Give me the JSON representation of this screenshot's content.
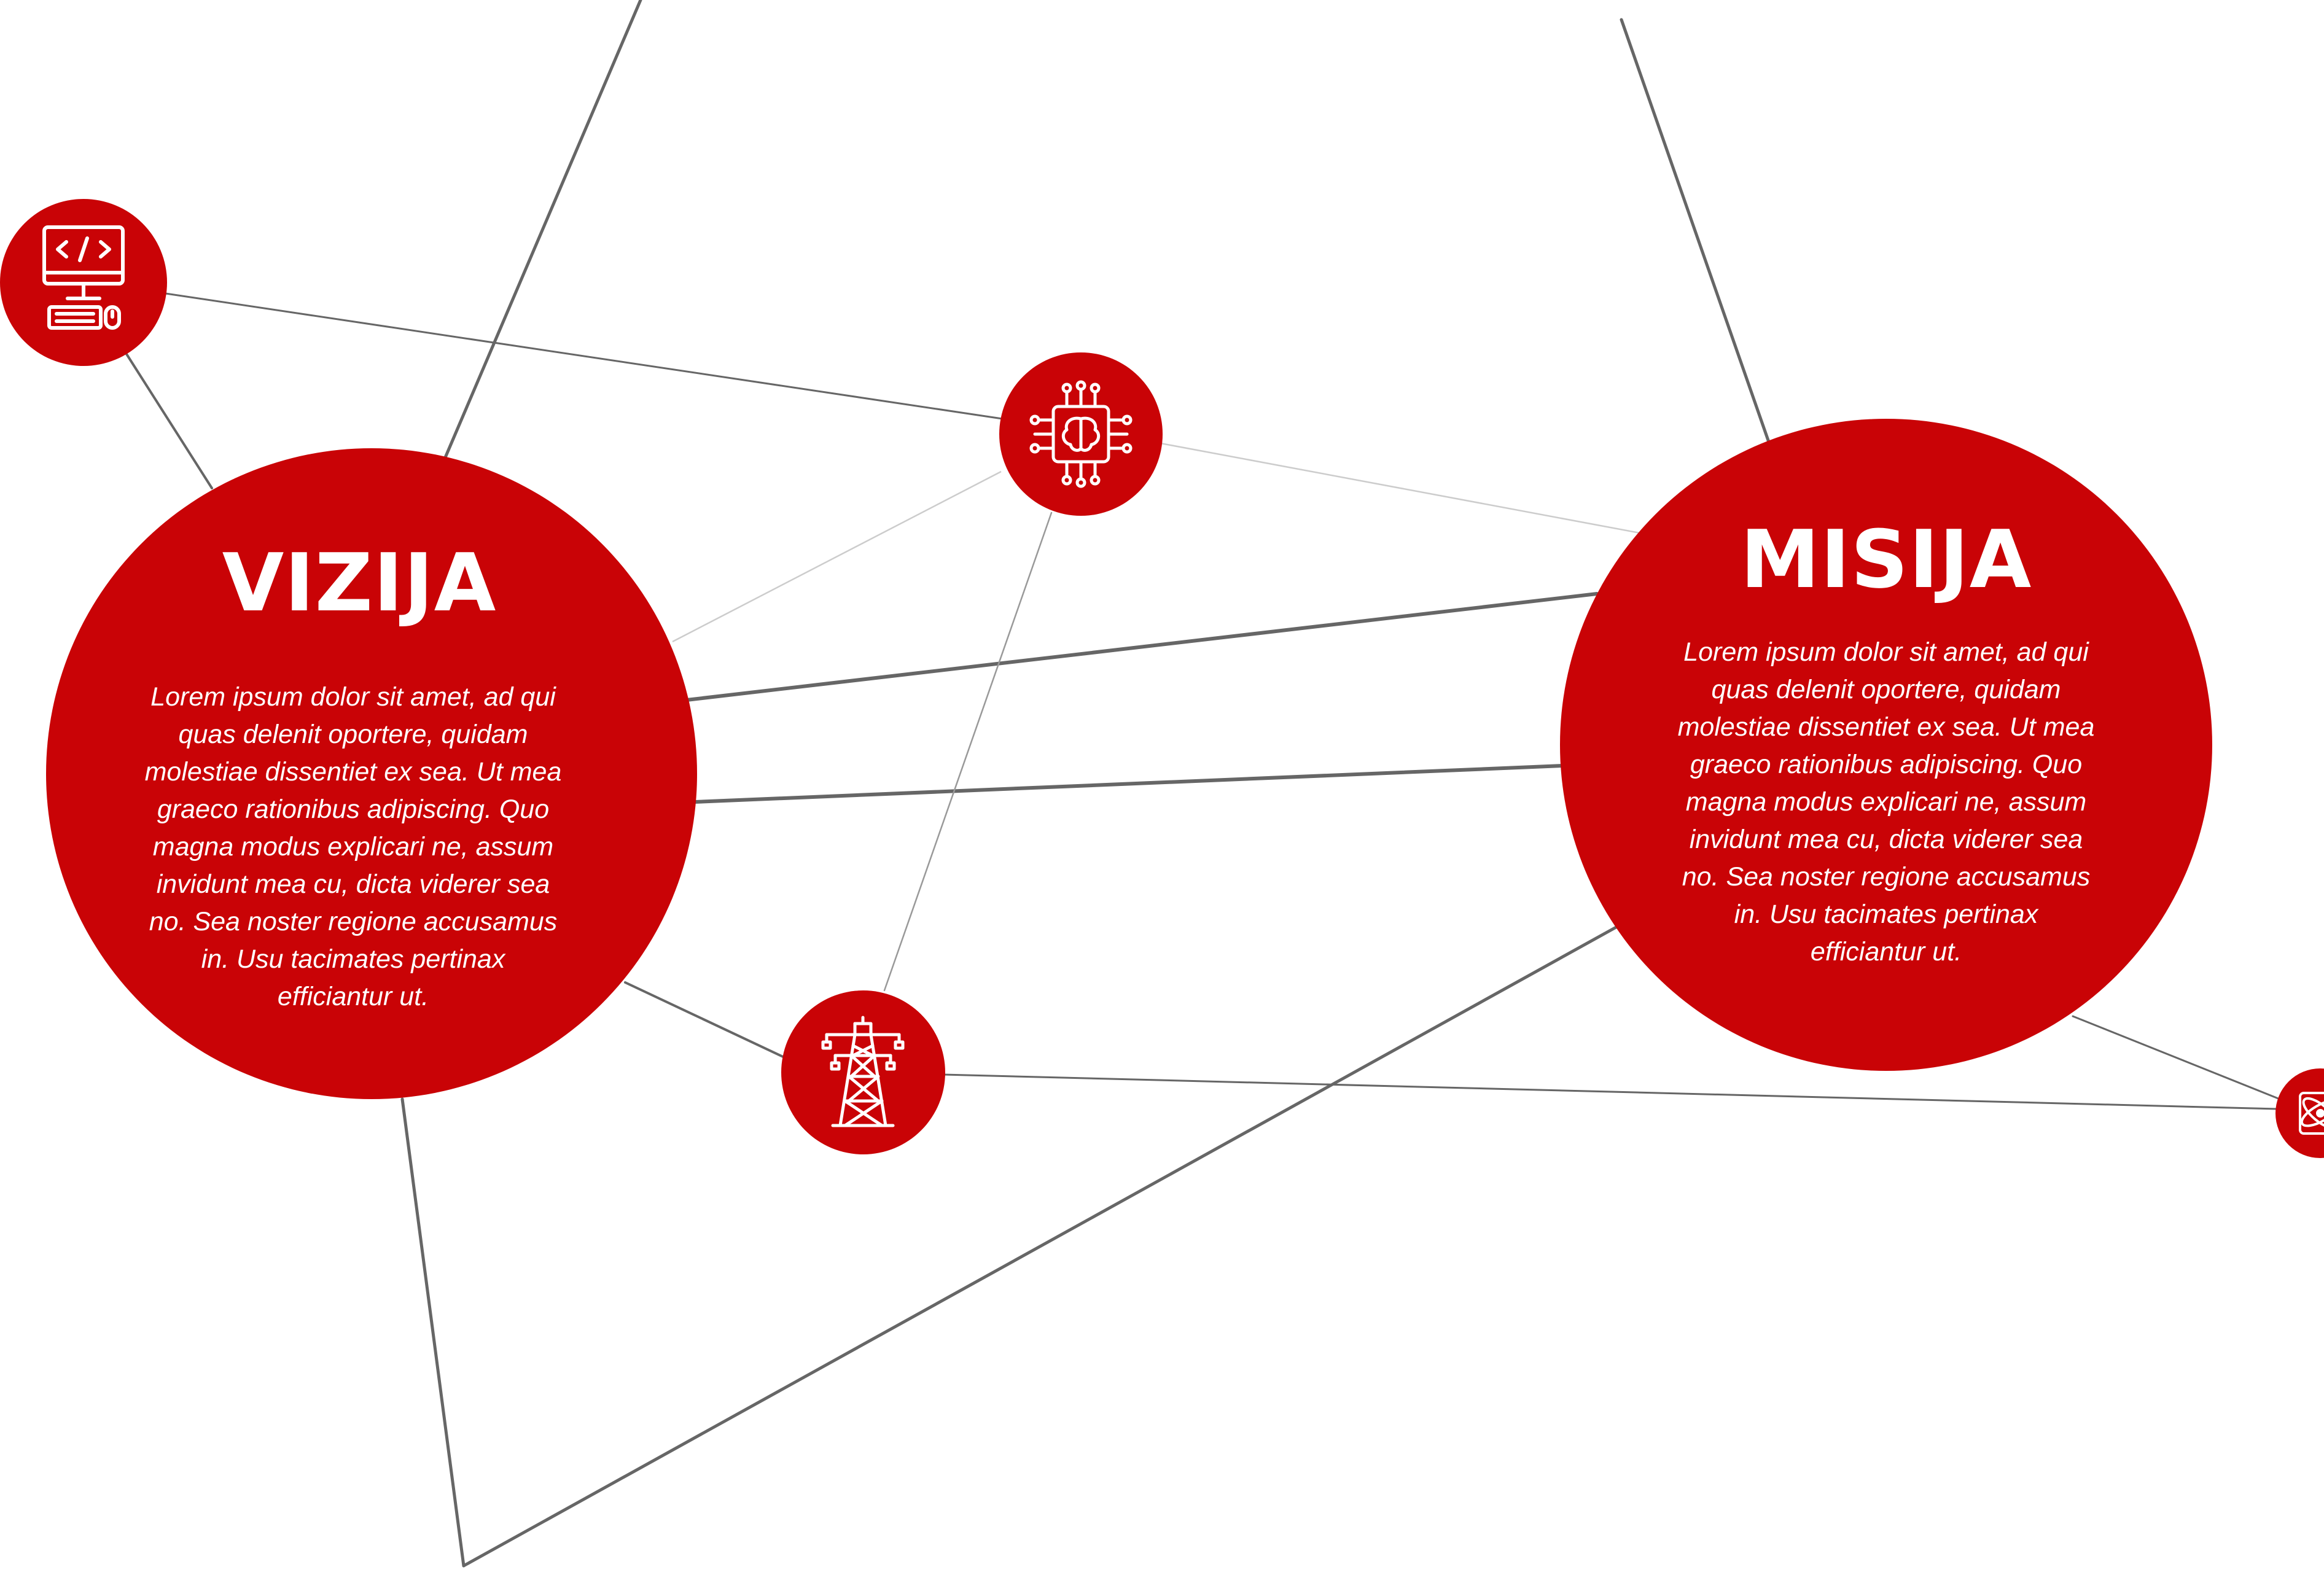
{
  "colors": {
    "accent": "#c90306",
    "line": "#666666",
    "line_light": "#cccccc",
    "text_on_accent": "#ffffff"
  },
  "vizija": {
    "title": "VIZIJA",
    "text": "Lorem ipsum dolor sit amet, ad qui quas delenit oportere, quidam molestiae dissentiet ex sea. Ut mea graeco rationibus adipiscing. Quo magna modus explicari ne, assum invidunt mea cu, dicta viderer sea no. Sea noster regione accusamus in. Usu tacimates pertinax efficiantur ut."
  },
  "misija": {
    "title": "MISIJA",
    "text": "Lorem ipsum dolor sit amet, ad qui quas delenit oportere, quidam molestiae dissentiet ex sea. Ut mea graeco rationibus adipiscing. Quo magna modus explicari ne, assum invidunt mea cu, dicta viderer sea no. Sea noster regione accusamus in. Usu tacimates pertinax efficiantur ut."
  },
  "icons": {
    "code": "computer-code-icon",
    "ai": "ai-brain-chip-icon",
    "tower": "power-tower-icon",
    "atom": "atom-icon"
  }
}
